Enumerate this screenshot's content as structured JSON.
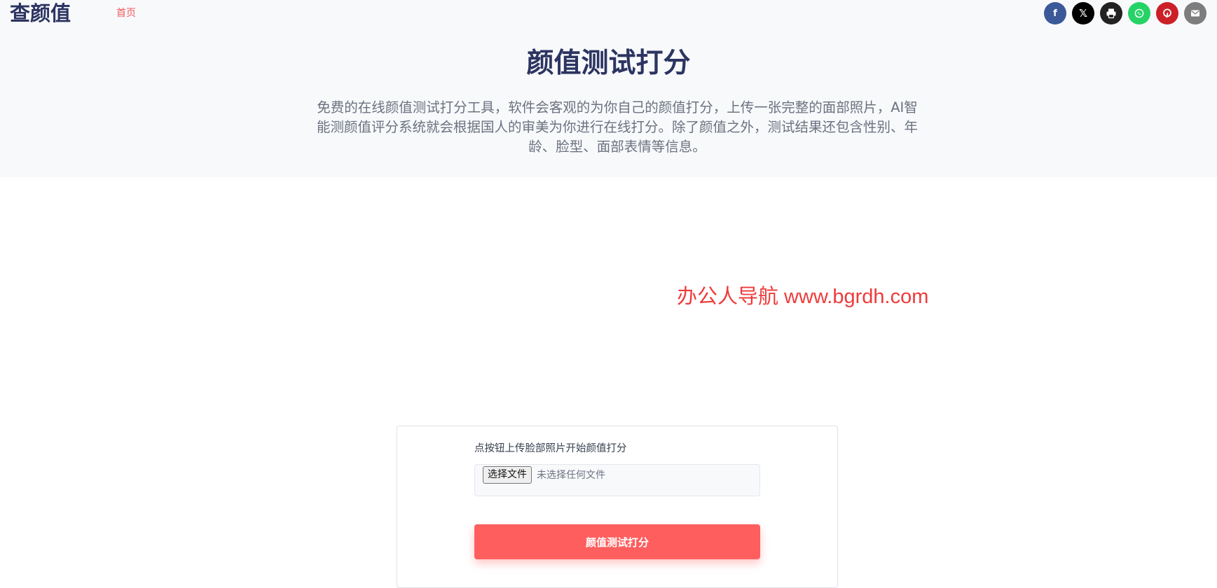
{
  "header": {
    "logo": "查颜值",
    "nav": [
      {
        "label": "首页"
      }
    ]
  },
  "share": [
    {
      "name": "facebook",
      "glyph": "f",
      "color": "#3b5998"
    },
    {
      "name": "x",
      "glyph": "𝕏",
      "color": "#000000"
    },
    {
      "name": "print",
      "glyph": "",
      "color": "#222222"
    },
    {
      "name": "whatsapp",
      "glyph": "",
      "color": "#25d366"
    },
    {
      "name": "pinterest",
      "glyph": "",
      "color": "#cb2027"
    },
    {
      "name": "email",
      "glyph": "",
      "color": "#7d7d7d"
    }
  ],
  "hero": {
    "title": "颜值测试打分",
    "description": "免费的在线颜值测试打分工具，软件会客观的为你自己的颜值打分，上传一张完整的面部照片，AI智能测颜值评分系统就会根据国人的审美为你进行在线打分。除了颜值之外，测试结果还包含性别、年龄、脸型、面部表情等信息。"
  },
  "watermark": "办公人导航 www.bgrdh.com",
  "upload": {
    "label": "点按钮上传脸部照片开始颜值打分",
    "file_button": "选择文件",
    "file_status": "未选择任何文件",
    "submit": "颜值测试打分"
  },
  "colors": {
    "brand": "#2c3461",
    "accent": "#ff5e5e"
  }
}
